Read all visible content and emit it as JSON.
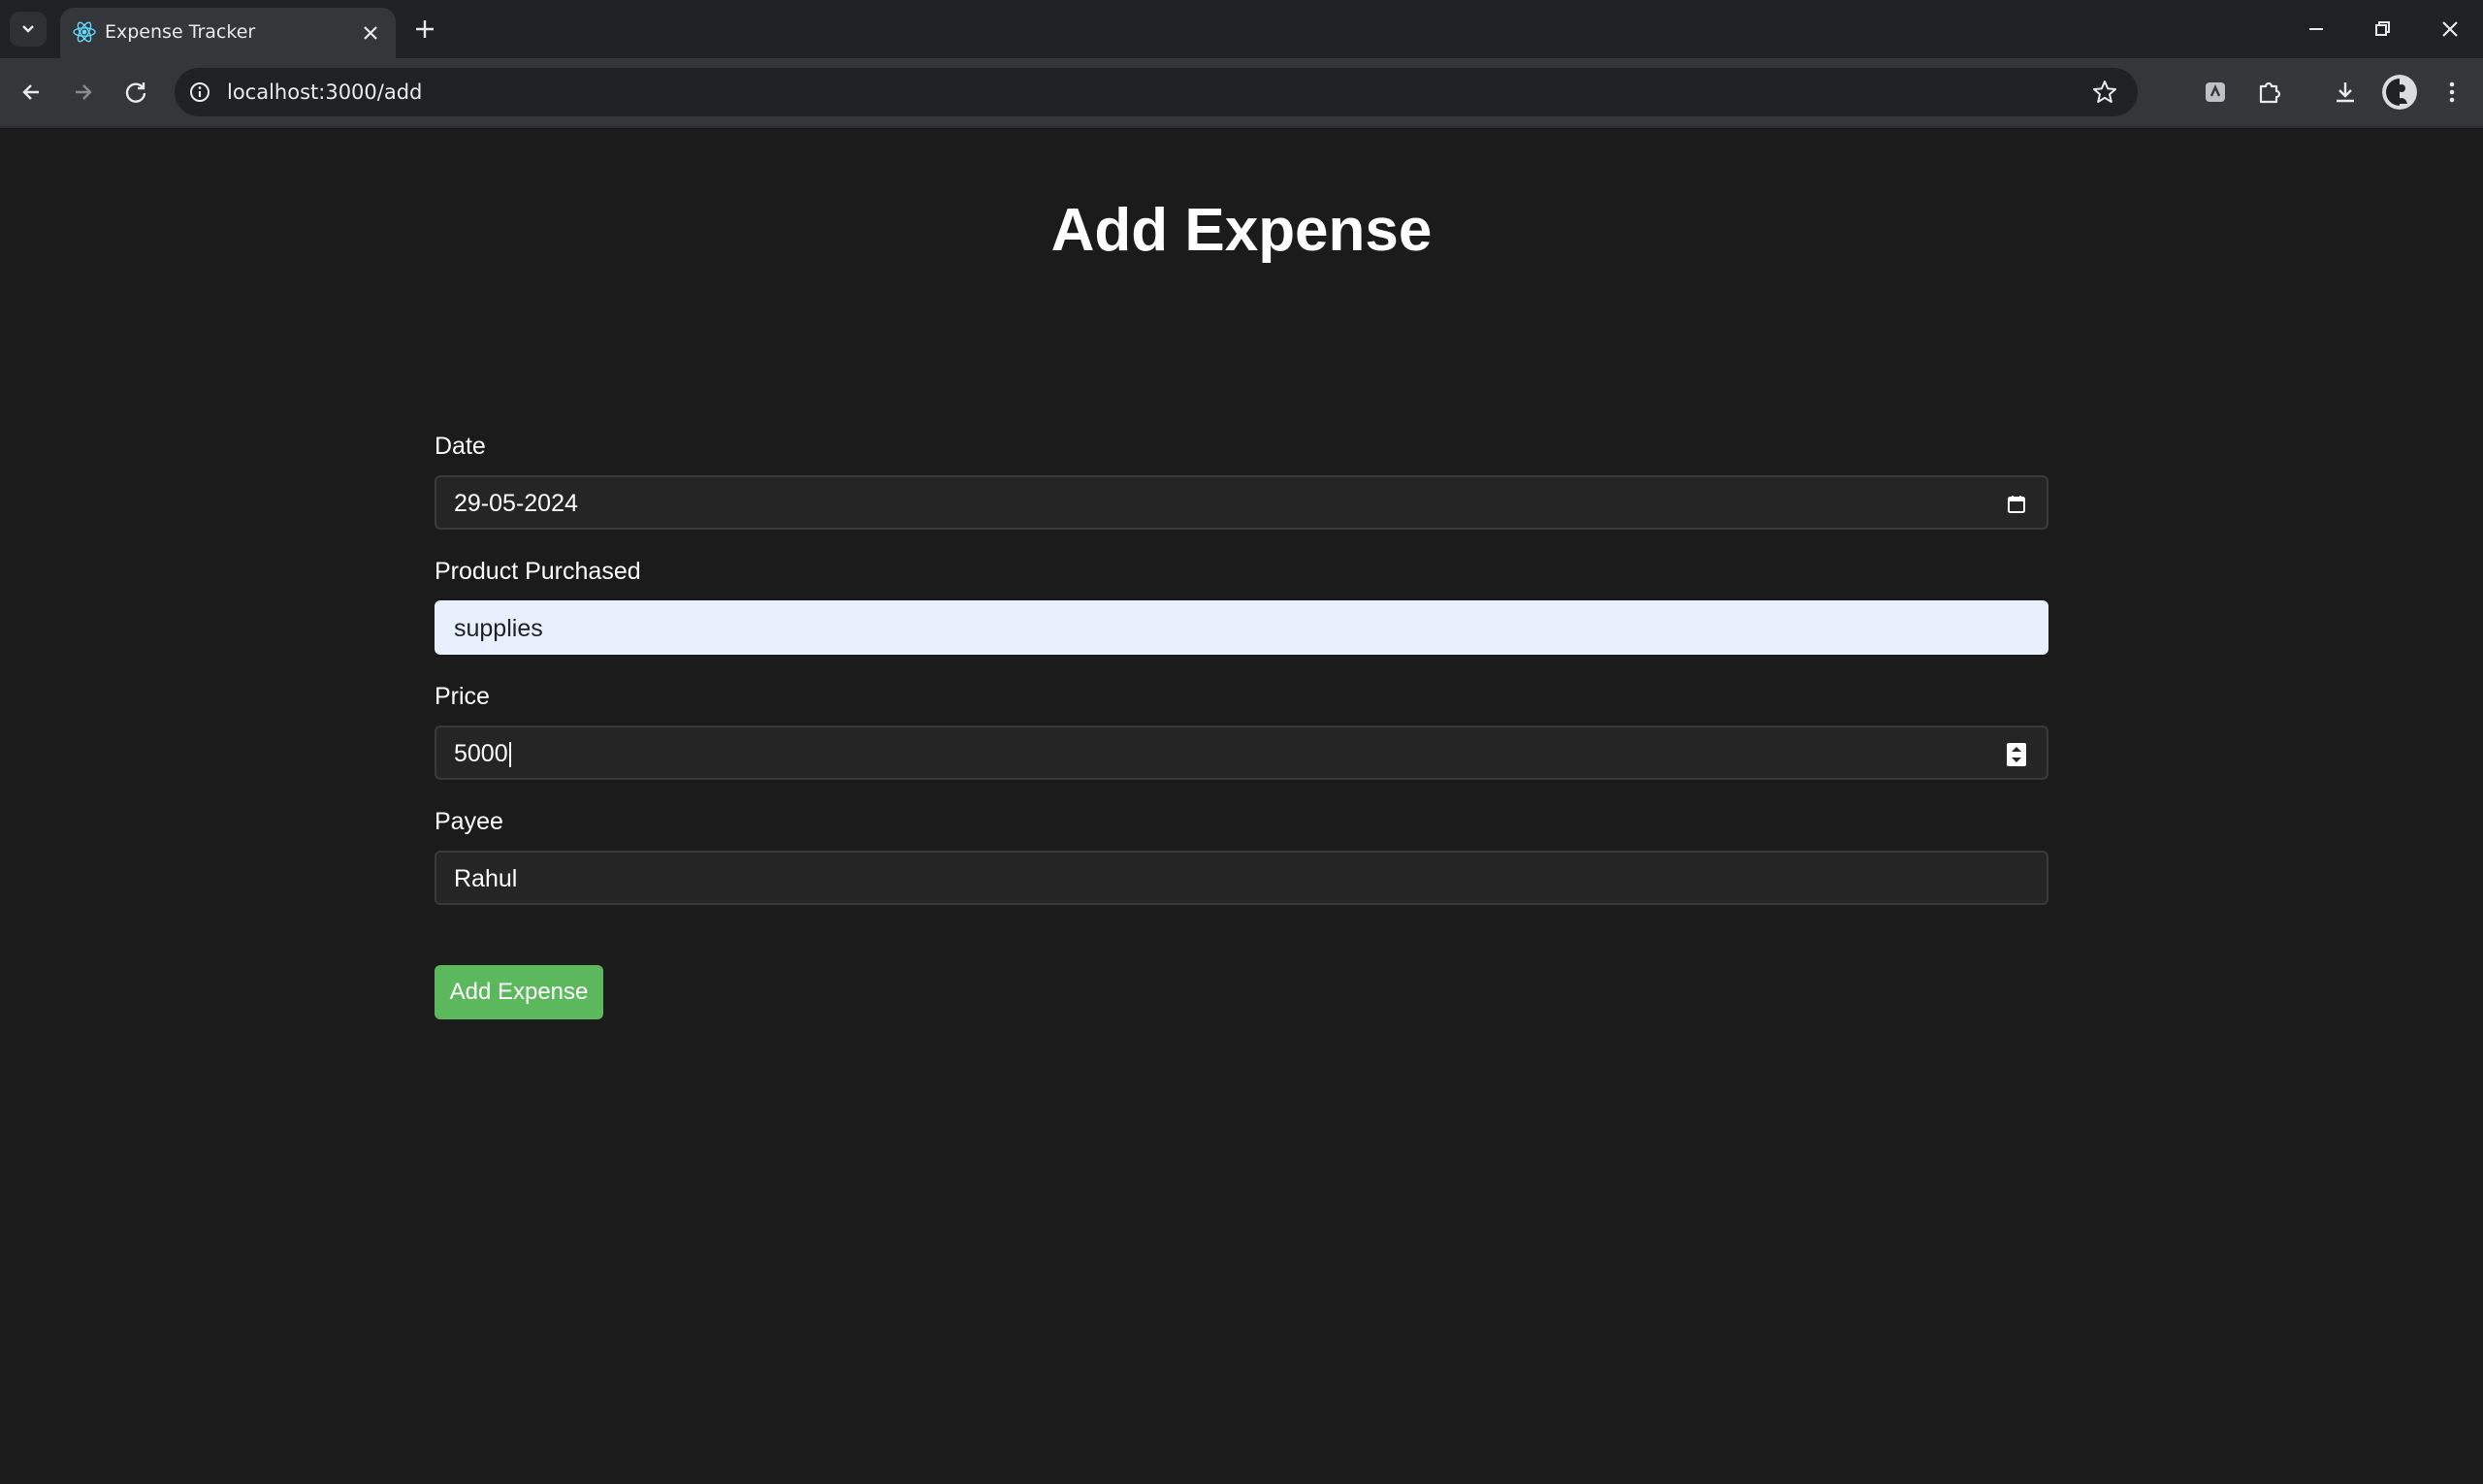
{
  "browser": {
    "tab_title": "Expense Tracker",
    "url": "localhost:3000/add",
    "icons": {
      "tab_search": "chevron-down-icon",
      "favicon": "react-icon",
      "tab_close": "close-icon",
      "new_tab": "plus-icon",
      "back": "back-arrow-icon",
      "forward": "forward-arrow-icon",
      "reload": "reload-icon",
      "site_info": "info-icon",
      "bookmark": "star-icon",
      "extension_a": "extension-icon",
      "extensions": "puzzle-icon",
      "downloads": "download-icon",
      "profile": "avatar",
      "menu": "more-vertical-icon",
      "minimize": "minimize-icon",
      "restore": "restore-icon",
      "close": "close-icon"
    }
  },
  "page": {
    "title": "Add Expense",
    "fields": {
      "date": {
        "label": "Date",
        "value": "29-05-2024",
        "icon": "calendar-icon"
      },
      "product": {
        "label": "Product Purchased",
        "value": "supplies"
      },
      "price": {
        "label": "Price",
        "value": "5000",
        "icon": "spinner-icon"
      },
      "payee": {
        "label": "Payee",
        "value": "Rahul"
      }
    },
    "submit_label": "Add Expense"
  },
  "colors": {
    "background": "#1b1b1b",
    "input_background": "#252525",
    "autofill_background": "#e8f0fe",
    "button": "#5cb85c",
    "text": "#ffffff"
  }
}
